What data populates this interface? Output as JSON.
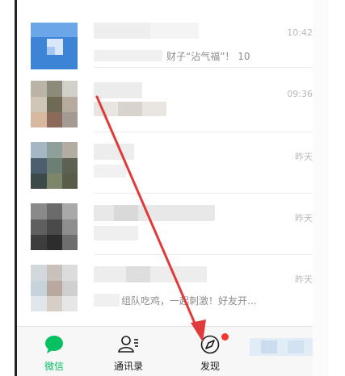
{
  "colors": {
    "accent_green": "#07c160",
    "badge_red": "#f43530",
    "annotation_red": "#e03a3a",
    "timestamp_gray": "#b8b8b8"
  },
  "chats": [
    {
      "time": "10:42",
      "preview": "财子“沾气福”！ 10",
      "avatar": "blue-tile-avatar"
    },
    {
      "time": "09:36",
      "preview": "",
      "avatar": "pixelated-avatar"
    },
    {
      "time": "昨天",
      "preview": "",
      "avatar": "pixelated-avatar"
    },
    {
      "time": "昨天",
      "preview": "",
      "avatar": "pixelated-avatar"
    },
    {
      "time": "昨天",
      "preview": "组队吃鸡，一起刺激！好友开...",
      "avatar": "pixelated-avatar"
    }
  ],
  "tabbar": {
    "tabs": [
      {
        "label": "微信",
        "icon": "chat-bubble-icon",
        "active": true
      },
      {
        "label": "通讯录",
        "icon": "contacts-icon",
        "active": false
      },
      {
        "label": "发现",
        "icon": "compass-icon",
        "active": false,
        "badge": true
      }
    ]
  },
  "annotation": {
    "type": "arrow",
    "points_to": "tab-discover"
  }
}
